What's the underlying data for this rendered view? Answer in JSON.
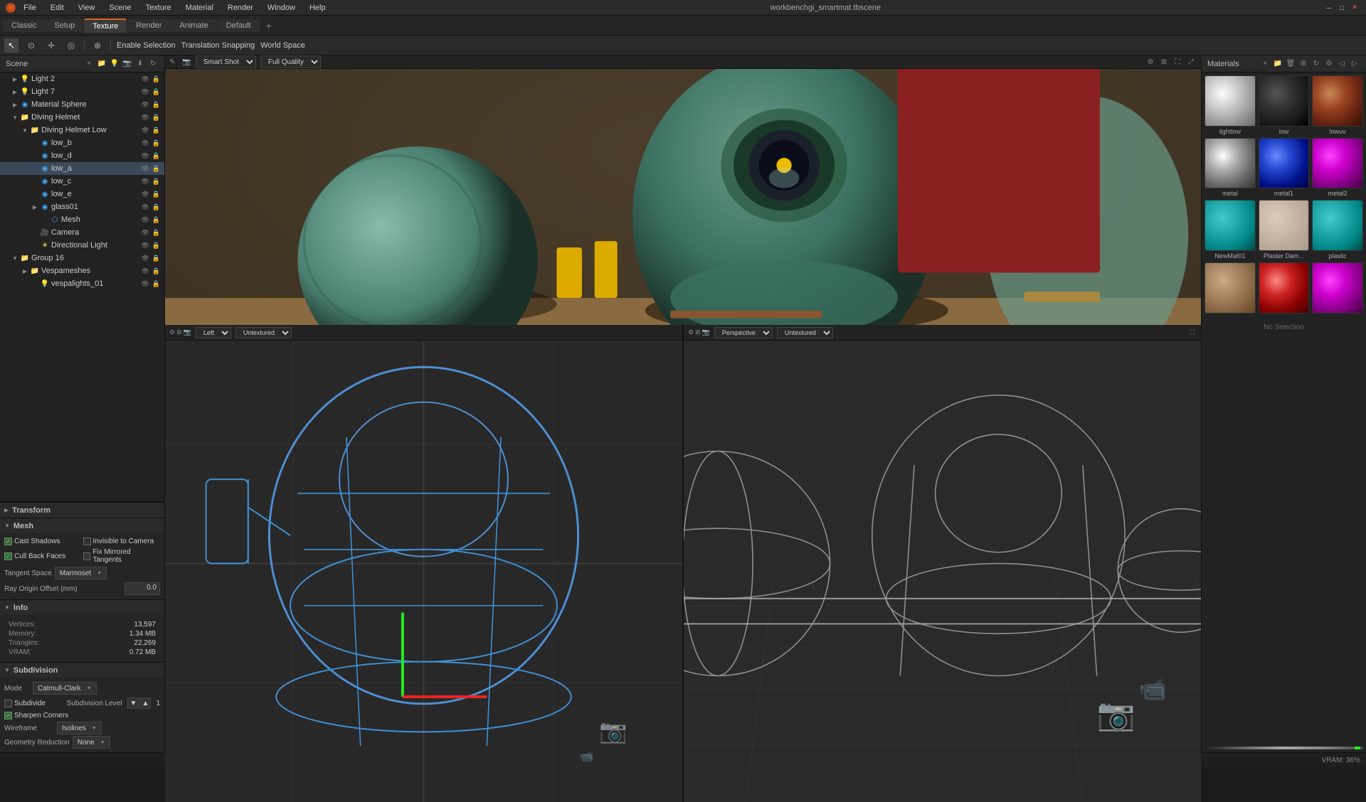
{
  "titlebar": {
    "menu_items": [
      "File",
      "Edit",
      "View",
      "Scene",
      "Texture",
      "Material",
      "Render",
      "Window",
      "Help"
    ],
    "title": "workbenchgi_smartmat.tbscene",
    "minimize": "─",
    "maximize": "□",
    "close": "✕"
  },
  "tabs": {
    "items": [
      "Classic",
      "Setup",
      "Texture",
      "Render",
      "Animate",
      "Default"
    ],
    "active": 2,
    "plus": "+"
  },
  "toolbar2": {
    "enable_selection": "Enable Selection",
    "translation_snapping": "Translation Snapping",
    "world_space": "World Space"
  },
  "scene": {
    "title": "Scene",
    "tree": [
      {
        "id": "light2",
        "label": "Light 2",
        "type": "light",
        "indent": 1,
        "expanded": false
      },
      {
        "id": "light7",
        "label": "Light 7",
        "type": "light",
        "indent": 1,
        "expanded": false
      },
      {
        "id": "material_sphere",
        "label": "Material Sphere",
        "type": "mesh",
        "indent": 1,
        "expanded": false
      },
      {
        "id": "diving_helmet",
        "label": "Diving Helmet",
        "type": "folder",
        "indent": 1,
        "expanded": true
      },
      {
        "id": "diving_helmet_low",
        "label": "Diving Helmet Low",
        "type": "folder",
        "indent": 2,
        "expanded": true
      },
      {
        "id": "low_b",
        "label": "low_b",
        "type": "mesh",
        "indent": 3,
        "expanded": false
      },
      {
        "id": "low_d",
        "label": "low_d",
        "type": "mesh",
        "indent": 3,
        "expanded": false
      },
      {
        "id": "low_a",
        "label": "low_a",
        "type": "mesh",
        "indent": 3,
        "expanded": false,
        "selected": true
      },
      {
        "id": "low_c",
        "label": "low_c",
        "type": "mesh",
        "indent": 3,
        "expanded": false
      },
      {
        "id": "low_e",
        "label": "low_e",
        "type": "mesh",
        "indent": 3,
        "expanded": false
      },
      {
        "id": "glass01",
        "label": "glass01",
        "type": "mesh",
        "indent": 3,
        "expanded": false
      },
      {
        "id": "mesh",
        "label": "Mesh",
        "type": "mesh",
        "indent": 4,
        "expanded": false
      },
      {
        "id": "camera",
        "label": "Camera",
        "type": "camera",
        "indent": 3,
        "expanded": false
      },
      {
        "id": "directional_light",
        "label": "Directional Light",
        "type": "light",
        "indent": 3,
        "expanded": false
      },
      {
        "id": "group16",
        "label": "Group 16",
        "type": "folder",
        "indent": 1,
        "expanded": true
      },
      {
        "id": "vespameshes",
        "label": "Vespameshes",
        "type": "folder",
        "indent": 2,
        "expanded": false
      },
      {
        "id": "vespalights_01",
        "label": "vespalights_01",
        "type": "mesh",
        "indent": 3,
        "expanded": false
      }
    ]
  },
  "transform": {
    "title": "Transform"
  },
  "mesh": {
    "title": "Mesh",
    "cast_shadows": "Cast Shadows",
    "cast_shadows_checked": true,
    "invisible_to_camera": "Invisible to Camera",
    "invisible_checked": false,
    "cull_back_faces": "Cull Back Faces",
    "cull_checked": true,
    "fix_mirrored": "Fix Mirrored Tangents",
    "fix_checked": false,
    "tangent_space": "Tangent Space",
    "tangent_val": "Marmoset",
    "ray_origin_label": "Ray Origin Offset (mm)",
    "ray_origin_val": "0.0"
  },
  "info": {
    "title": "Info",
    "vertices_label": "Vertices:",
    "vertices_val": "13,597",
    "memory_label": "Memory:",
    "memory_val": "1.34 MB",
    "triangles_label": "Triangles:",
    "triangles_val": "22,269",
    "vram_label": "VRAM:",
    "vram_val": "0.72 MB"
  },
  "subdivision": {
    "title": "Subdivision",
    "mode_label": "Mode",
    "mode_val": "Catmull-Clark",
    "subdivide_label": "Subdivide",
    "subdivision_level": "Subdivision Level",
    "level_val": "1",
    "sharpen_corners": "Sharpen Corners",
    "sharpen_checked": true,
    "wireframe_label": "Wireframe",
    "wireframe_val": "Isolines",
    "geo_reduction_label": "Geometry Reduction",
    "geo_reduction_val": "None"
  },
  "viewport_main": {
    "edit_icon": "✎",
    "camera_icon": "📷",
    "smart_shot_label": "Smart Shot",
    "quality_label": "Full Quality"
  },
  "viewport_left": {
    "label": "Left",
    "render_mode": "Untextured"
  },
  "viewport_perspective": {
    "label": "Perspective",
    "render_mode": "Untextured"
  },
  "materials": {
    "title": "Materials",
    "items": [
      {
        "id": "lightlow",
        "name": "lightlow",
        "style": "sphere-light"
      },
      {
        "id": "low",
        "name": "low",
        "style": "sphere-dark"
      },
      {
        "id": "lowuv",
        "name": "lowuv",
        "style": "sphere-lowuv"
      },
      {
        "id": "metal",
        "name": "metal",
        "style": "sphere-metal"
      },
      {
        "id": "metal1",
        "name": "metal1",
        "style": "sphere-metal1"
      },
      {
        "id": "metal2",
        "name": "metal2",
        "style": "sphere-metal2"
      },
      {
        "id": "newmat01",
        "name": "NewMat01",
        "style": "sphere-newmat"
      },
      {
        "id": "plaster",
        "name": "Plaster Dam...",
        "style": "sphere-plaster"
      },
      {
        "id": "plastic",
        "name": "plastic",
        "style": "sphere-plastic"
      },
      {
        "id": "row4_1",
        "name": "",
        "style": "sphere-r1"
      },
      {
        "id": "row4_2",
        "name": "",
        "style": "sphere-r2"
      },
      {
        "id": "row4_3",
        "name": "",
        "style": "sphere-r3"
      }
    ],
    "no_selection": "No Selection"
  },
  "statusbar": {
    "vram_text": "VRAM: 36%"
  }
}
